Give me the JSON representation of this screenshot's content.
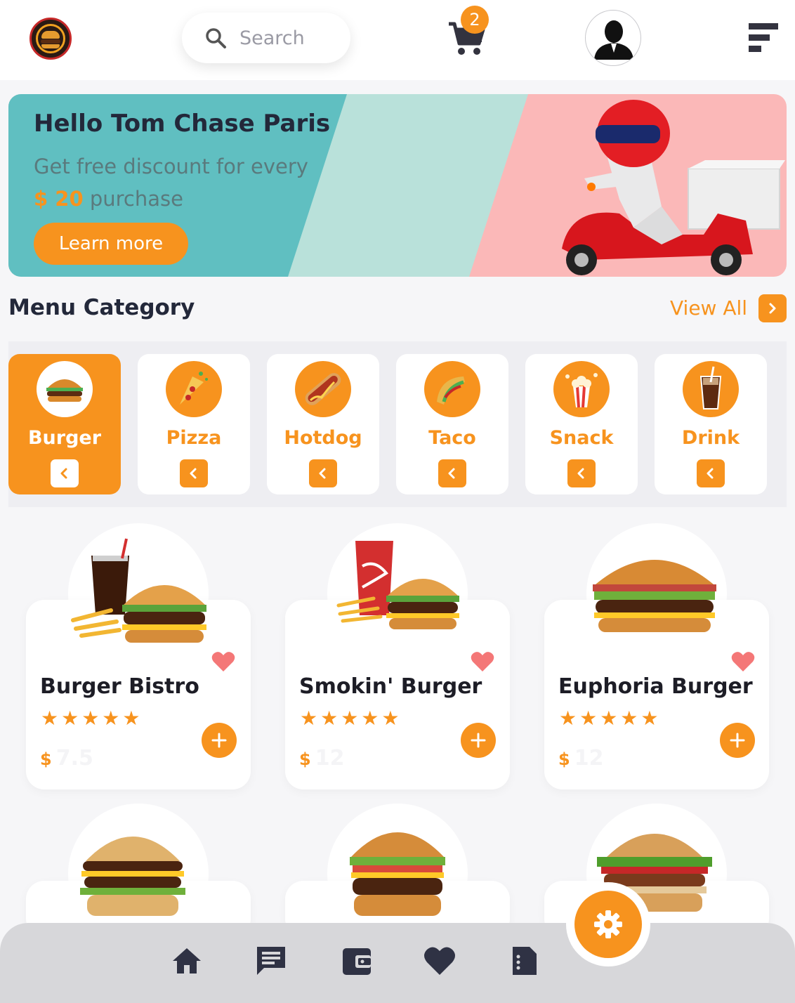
{
  "header": {
    "search_placeholder": "Search",
    "cart_count": "2",
    "icons": [
      "burger-logo",
      "search-icon",
      "cart-icon",
      "user-avatar",
      "menu-icon"
    ]
  },
  "banner": {
    "greeting": "Hello Tom Chase Paris",
    "line1": "Get free discount for every",
    "amount": "$ 20",
    "line2_suffix": "purchase",
    "button": "Learn more"
  },
  "section": {
    "title": "Menu Category",
    "view_all": "View All"
  },
  "categories": [
    {
      "label": "Burger",
      "active": true
    },
    {
      "label": "Pizza",
      "active": false
    },
    {
      "label": "Hotdog",
      "active": false
    },
    {
      "label": "Taco",
      "active": false
    },
    {
      "label": "Snack",
      "active": false
    },
    {
      "label": "Drink",
      "active": false
    }
  ],
  "products": [
    {
      "name": "Burger Bistro",
      "rating": 5,
      "stars": "★★★★★",
      "currency": "$",
      "price": "7.5"
    },
    {
      "name": "Smokin' Burger",
      "rating": 5,
      "stars": "★★★★★",
      "currency": "$",
      "price": "12"
    },
    {
      "name": "Euphoria Burger",
      "rating": 5,
      "stars": "★★★★★",
      "currency": "$",
      "price": "12"
    }
  ],
  "bottom_nav": [
    "home-icon",
    "chat-icon",
    "wallet-icon",
    "heart-icon",
    "document-icon",
    "settings-icon"
  ],
  "colors": {
    "accent": "#f7931e",
    "teal": "#5fbfc0",
    "mint": "#b8e0da",
    "pink": "#fbb8b8",
    "dark": "#23283a"
  }
}
